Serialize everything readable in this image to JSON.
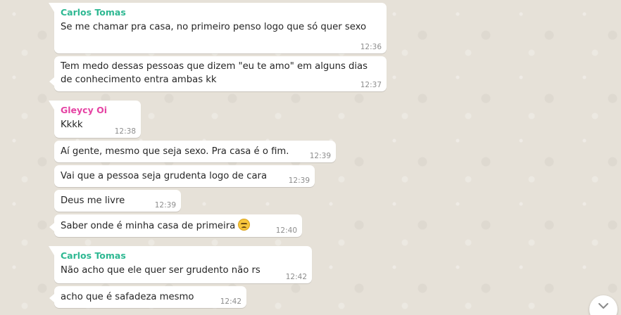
{
  "colors": {
    "sender_carlos": "#2eb892",
    "sender_gleycy": "#e542a3"
  },
  "messages": [
    {
      "sender": "Carlos Tomas",
      "text": "Se me chamar pra casa, no primeiro penso logo que só quer sexo",
      "time": "12:36"
    },
    {
      "text": "Tem medo dessas pessoas que dizem \"eu te amo\" em alguns dias de conhecimento entra ambas kk",
      "time": "12:37"
    },
    {
      "sender": "Gleycy Oi",
      "text": "Kkkk",
      "time": "12:38"
    },
    {
      "text": "Aí gente, mesmo que seja sexo. Pra casa é o fim.",
      "time": "12:39"
    },
    {
      "text": "Vai que a pessoa seja grudenta logo de cara",
      "time": "12:39"
    },
    {
      "text": "Deus me livre",
      "time": "12:39"
    },
    {
      "text": "Saber onde é minha casa de primeira",
      "emoji": "persevering-face-emoji",
      "time": "12:40"
    },
    {
      "sender": "Carlos Tomas",
      "text": "Não acho que ele quer ser grudento não rs",
      "time": "12:42"
    },
    {
      "text": "acho que é safadeza mesmo",
      "time": "12:42"
    }
  ],
  "scroll_down": {
    "icon": "chevron-down-icon"
  }
}
